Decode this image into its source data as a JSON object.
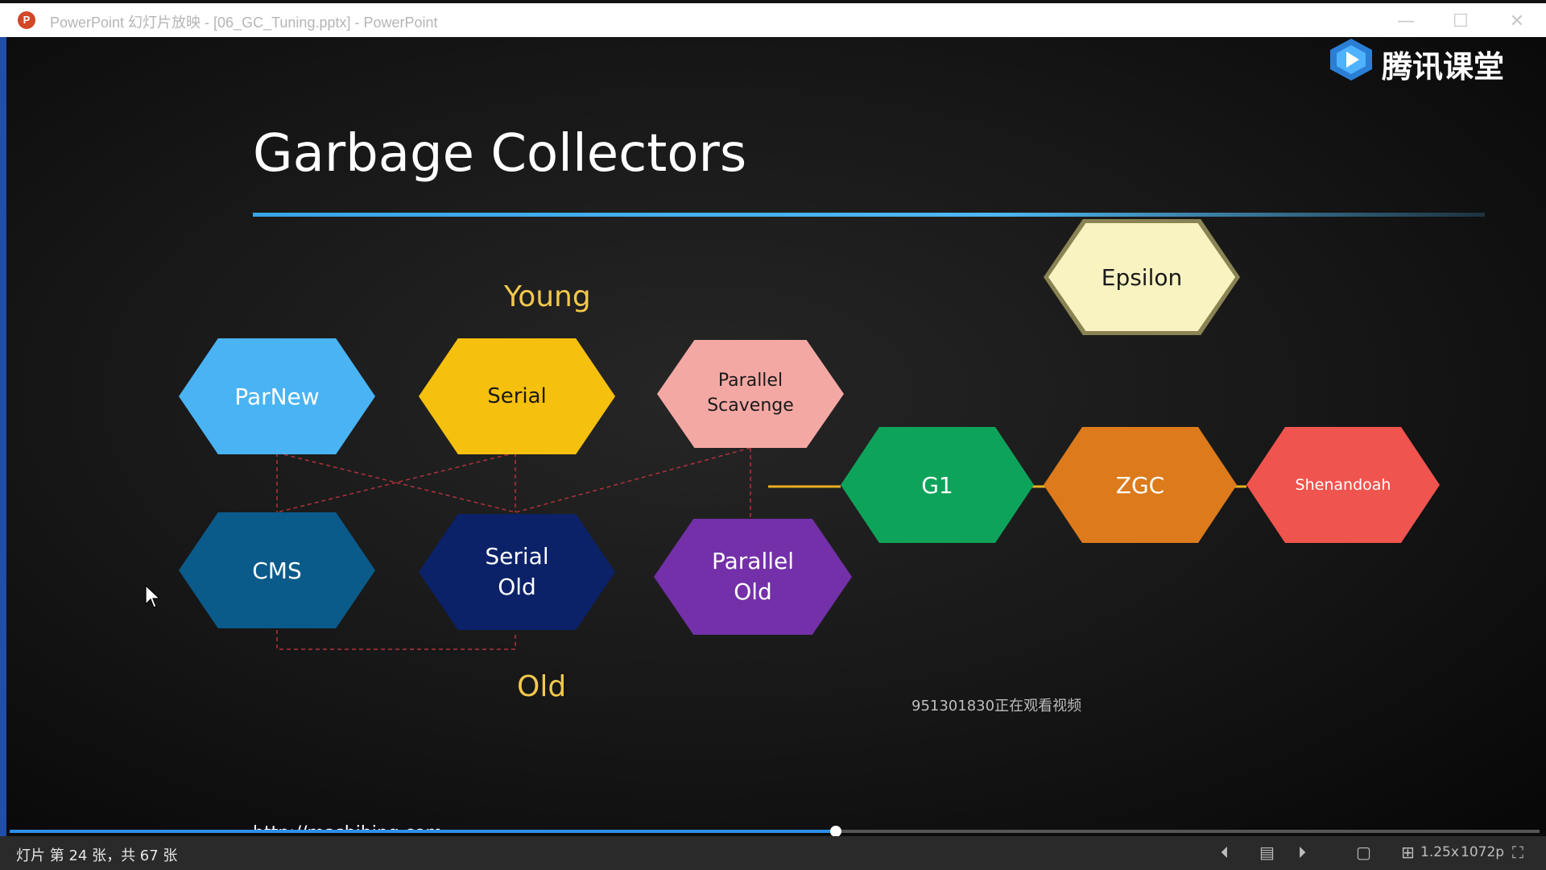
{
  "window": {
    "title": "PowerPoint 幻灯片放映 - [06_GC_Tuning.pptx] - PowerPoint",
    "app_icon": "powerpoint-icon",
    "app_icon_letter": "P",
    "controls": {
      "minimize": "—",
      "maximize": "☐",
      "close": "✕"
    }
  },
  "brand": {
    "name": "腾讯课堂",
    "icon": "tencent-classroom-play-icon"
  },
  "slide": {
    "title": "Garbage Collectors",
    "young_label": "Young",
    "old_label": "Old",
    "url": "http://mashibing.com",
    "collectors": {
      "parnew": {
        "label": "ParNew",
        "color": "#4ab3f3"
      },
      "serial": {
        "label": "Serial",
        "color": "#f6c00e"
      },
      "parallel_scavenge": {
        "label": "Parallel\nScavenge",
        "color": "#f4a8a4"
      },
      "cms": {
        "label": "CMS",
        "color": "#0a5a8a"
      },
      "serial_old": {
        "label": "Serial\nOld",
        "color": "#0b2168"
      },
      "parallel_old": {
        "label": "Parallel\nOld",
        "color": "#7330a8"
      },
      "epsilon": {
        "label": "Epsilon",
        "color": "#f9f3c2"
      },
      "g1": {
        "label": "G1",
        "color": "#0ea35a"
      },
      "zgc": {
        "label": "ZGC",
        "color": "#dc7a1c"
      },
      "shenandoah": {
        "label": "Shenandoah",
        "color": "#f0544e"
      }
    },
    "accent_line": "#3aa3e6",
    "label_color": "#f2c84b"
  },
  "overlay": {
    "watermark": "951301830正在观看视频"
  },
  "playback": {
    "progress": 0.54,
    "status_text": "灯片 第 24 张，共 67 张",
    "speed": "1.25x",
    "quality": "1072p"
  }
}
